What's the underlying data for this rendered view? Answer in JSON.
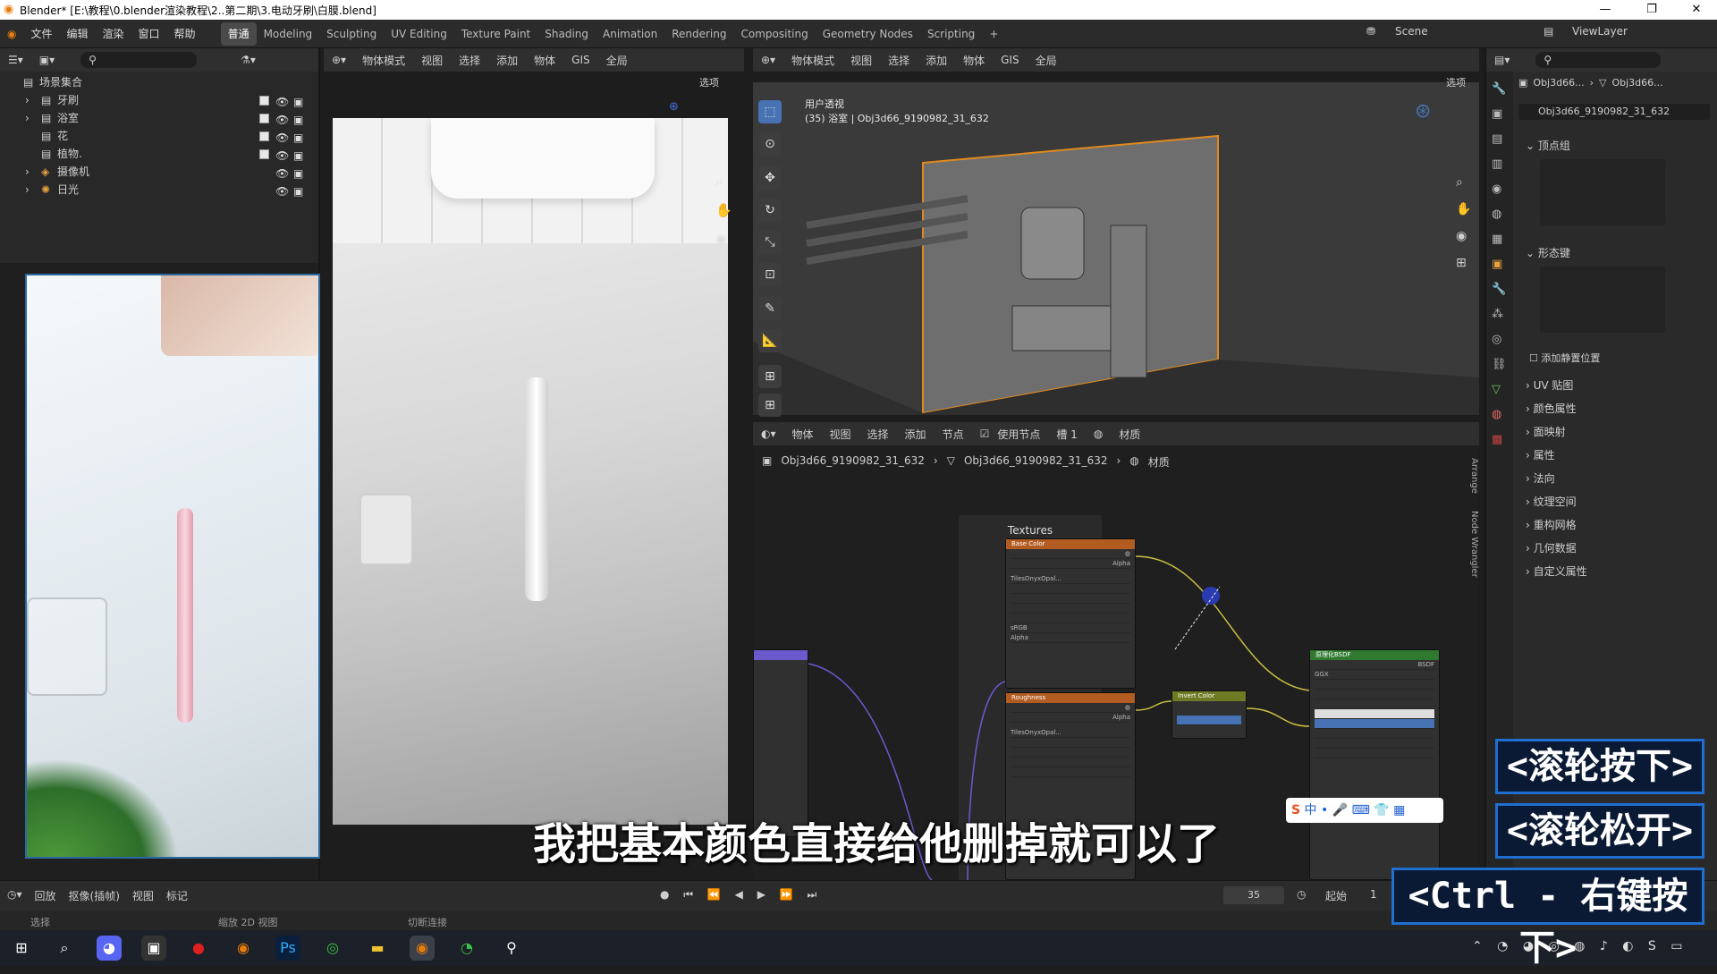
{
  "title_bar": {
    "title": "Blender* [E:\\教程\\0.blender渲染教程\\2..第二期\\3.电动牙刷\\白膜.blend]",
    "min": "—",
    "max": "❐",
    "close": "✕"
  },
  "menu": {
    "file": "文件",
    "edit": "编辑",
    "render": "渲染",
    "window": "窗口",
    "help": "帮助"
  },
  "workspaces": [
    "普通",
    "Modeling",
    "Sculpting",
    "UV Editing",
    "Texture Paint",
    "Shading",
    "Animation",
    "Rendering",
    "Compositing",
    "Geometry Nodes",
    "Scripting"
  ],
  "scene": {
    "name": "Scene",
    "view_layer": "ViewLayer"
  },
  "outliner": {
    "root": "场景集合",
    "items": [
      "牙刷",
      "浴室",
      "花",
      "植物.",
      "摄像机",
      "日光"
    ]
  },
  "render_header": {
    "mode": "物体模式",
    "view": "视图",
    "select": "选择",
    "add": "添加",
    "object": "物体",
    "gis": "GIS",
    "global": "全局",
    "options": "选项"
  },
  "viewport3d": {
    "mode": "物体模式",
    "view": "视图",
    "select": "选择",
    "add": "添加",
    "object": "物体",
    "gis": "GIS",
    "global": "全局",
    "options": "选项",
    "overlay_title": "用户透视",
    "overlay_info": "(35) 浴室 | Obj3d66_9190982_31_632"
  },
  "node_editor": {
    "type": "物体",
    "view": "视图",
    "select": "选择",
    "add": "添加",
    "node": "节点",
    "use_nodes": "使用节点",
    "slot": "槽 1",
    "material": "材质",
    "breadcrumb_obj": "Obj3d66_9190982_31_632",
    "breadcrumb_mesh": "Obj3d66_9190982_31_632",
    "breadcrumb_mat": "材质",
    "frame_label": "Textures",
    "node_base": "Base Color",
    "node_rough": "Roughness",
    "node_invert": "Invert Color",
    "node_bsdf": "原理化BSDF",
    "img_name": "TilesOnyxOpal...",
    "srgb": "sRGB",
    "side_tabs": [
      "Arrange",
      "Node Wrangler"
    ]
  },
  "props": {
    "crumb1": "Obj3d66...",
    "crumb2": "Obj3d66...",
    "mesh_name": "Obj3d66_9190982_31_632",
    "sections": [
      "顶点组",
      "形态键",
      "UV 贴图",
      "颜色属性",
      "面映射",
      "属性",
      "法向",
      "纹理空间",
      "重构网格",
      "几何数据",
      "自定义属性"
    ],
    "add_rest": "添加静置位置"
  },
  "timeline": {
    "playback": "回放",
    "keying": "抠像(插帧)",
    "view": "视图",
    "marker": "标记",
    "frame": "35",
    "start_label": "起始",
    "start": "1",
    "status_select": "选择",
    "status_zoom": "缩放 2D 视图",
    "status_cut": "切断连接"
  },
  "subtitle": "我把基本颜色直接给他删掉就可以了",
  "keys": [
    "<滚轮按下>",
    "<滚轮松开>",
    "<Ctrl - 右键按下>"
  ],
  "colors": {
    "accent": "#4772b3",
    "node_orange": "#b25c22",
    "node_green": "#2f7a2f",
    "key_border": "#1e6fd0"
  }
}
